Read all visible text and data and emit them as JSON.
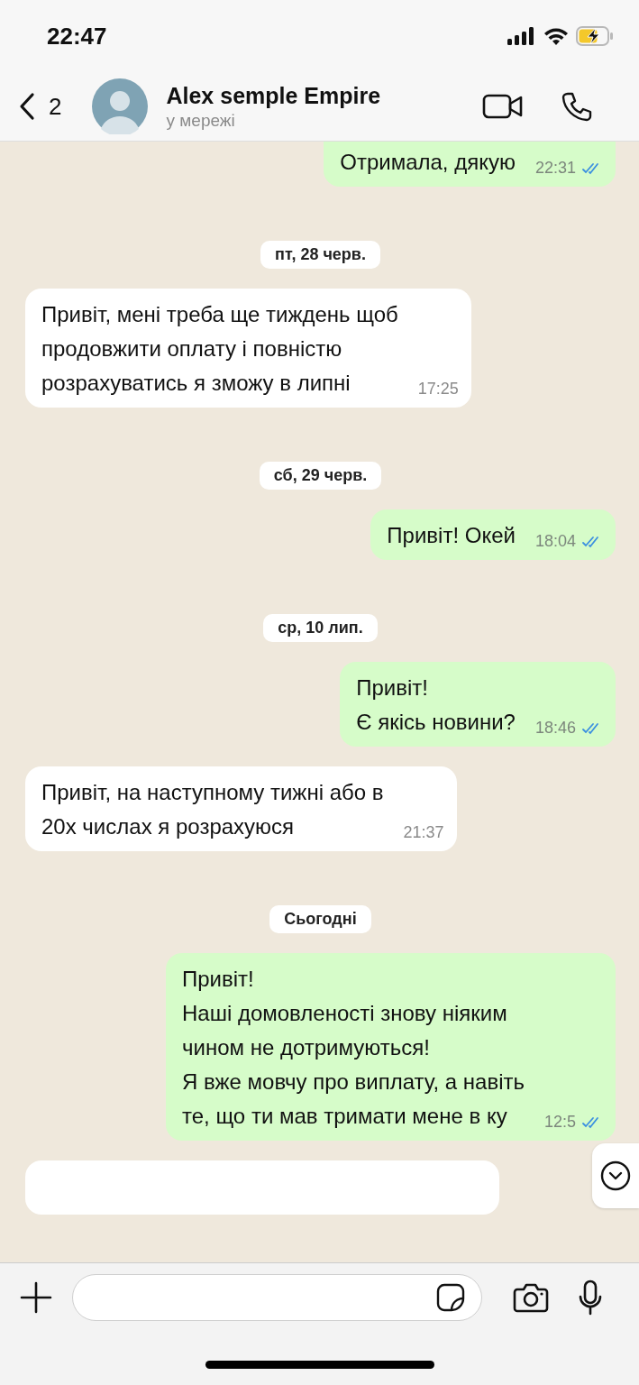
{
  "status_bar": {
    "time": "22:47"
  },
  "header": {
    "back_count": "2",
    "name": "Alex semple Empire",
    "status": "у мережі"
  },
  "messages": [
    {
      "kind": "out",
      "lines": [
        "Отримала, дякую"
      ],
      "time": "22:31",
      "read": true
    },
    {
      "kind": "date",
      "label": "пт, 28 черв."
    },
    {
      "kind": "in",
      "lines": [
        "Привіт, мені треба ще тиждень щоб",
        "продовжити оплату і повністю",
        "розрахуватись я зможу в липні"
      ],
      "time": "17:25"
    },
    {
      "kind": "date",
      "label": "сб, 29 черв."
    },
    {
      "kind": "out",
      "lines": [
        "Привіт! Окей"
      ],
      "time": "18:04",
      "read": true
    },
    {
      "kind": "date",
      "label": "ср, 10 лип."
    },
    {
      "kind": "out",
      "lines": [
        "Привіт!",
        "Є якісь новини?"
      ],
      "time": "18:46",
      "read": true
    },
    {
      "kind": "in",
      "lines": [
        "Привіт, на наступному тижні або в",
        "20х числах я розрахуюся"
      ],
      "time": "21:37"
    },
    {
      "kind": "date",
      "label": "Сьогодні"
    },
    {
      "kind": "out",
      "lines": [
        "Привіт!",
        "Наші домовленості знову ніяким",
        "чином не дотримуються!",
        "Я вже мовчу про виплату, а навіть",
        "те, що ти мав тримати мене в ку"
      ],
      "time": "12:5",
      "read": true
    },
    {
      "kind": "cut"
    }
  ]
}
